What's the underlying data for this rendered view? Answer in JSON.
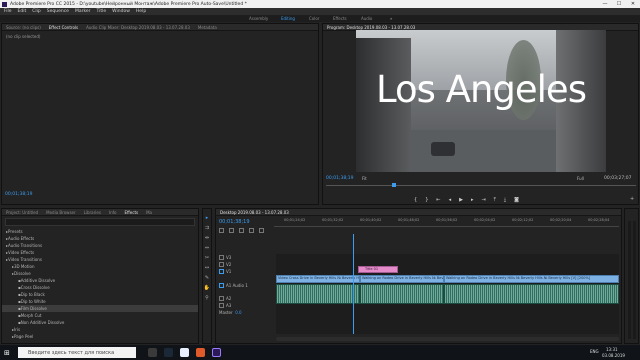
{
  "app": {
    "title": "Adobe Premiere Pro CC 2015 - D:\\youtube\\Нейронный Монтаж\\Adobe Premiere Pro Auto-Save\\Untitled *",
    "window_buttons": [
      "—",
      "☐",
      "✕"
    ]
  },
  "menu": [
    "File",
    "Edit",
    "Clip",
    "Sequence",
    "Marker",
    "Title",
    "Window",
    "Help"
  ],
  "workspaces": [
    "Assembly",
    "Editing",
    "Color",
    "Effects",
    "Audio"
  ],
  "active_workspace": "Editing",
  "source_panel": {
    "tabs": [
      "Source: (no clips)",
      "Effect Controls",
      "Audio Clip Mixer: Desktop 2019.08.03 - 13.07.28.03",
      "Metadata"
    ],
    "active_tab": "Effect Controls",
    "label": "(no clip selected)",
    "timecode": "00;01;38;19"
  },
  "program_panel": {
    "tab": "Program: Desktop 2019.08.03 - 13.07.28.03",
    "overlay_text": "Los Angeles",
    "timecode": "00;01;38;19",
    "fit": "Fit",
    "quality": "Full",
    "duration": "00;03;27;07"
  },
  "project_panel": {
    "tabs": [
      "Project: Untitled",
      "Media Browser",
      "Libraries",
      "Info",
      "Effects",
      "Ma"
    ],
    "active_tab": "Effects",
    "tree": [
      {
        "label": "Presets",
        "indent": 0
      },
      {
        "label": "Audio Effects",
        "indent": 0
      },
      {
        "label": "Audio Transitions",
        "indent": 0
      },
      {
        "label": "Video Effects",
        "indent": 0
      },
      {
        "label": "Video Transitions",
        "indent": 0
      },
      {
        "label": "3D Motion",
        "indent": 1
      },
      {
        "label": "Dissolve",
        "indent": 1
      },
      {
        "label": "Additive Dissolve",
        "indent": 2
      },
      {
        "label": "Cross Dissolve",
        "indent": 2
      },
      {
        "label": "Dip to Black",
        "indent": 2
      },
      {
        "label": "Dip to White",
        "indent": 2
      },
      {
        "label": "Film Dissolve",
        "indent": 2
      },
      {
        "label": "Morph Cut",
        "indent": 2
      },
      {
        "label": "Non Additive Dissolve",
        "indent": 2
      },
      {
        "label": "Iris",
        "indent": 1
      },
      {
        "label": "Page Peel",
        "indent": 1
      }
    ],
    "selected_item": "Film Dissolve"
  },
  "timeline": {
    "tab": "Desktop 2019.08.03 - 13.07.28.03",
    "timecode": "00;01;38;19",
    "ruler": [
      "00;01;24;02",
      "00;01;32;02",
      "00;01;40;02",
      "00;01;48;02",
      "00;01;56;02",
      "00;02;04;02",
      "00;02;12;02",
      "00;02;20;04",
      "00;02;28;04"
    ],
    "video_tracks": [
      "V3",
      "V2",
      "V1"
    ],
    "audio_tracks": [
      "A1",
      "A2",
      "A3"
    ],
    "title_clip": "Title 01",
    "video_clips": [
      "Video Cross Drive in Beverly Hills № Beverly Hills № Beverly Hills (17 [V] [235%]",
      "Walking on Rodeo Drive in Beverly Hills № Beverly Hills № [V] [235%]",
      "Walking on Rodeo Drive in Beverly Hills № Beverly Hills № Beverly Hills [V] [200%]"
    ],
    "master": "Master",
    "master_value": "0.0",
    "audio_label": "Audio 1"
  },
  "taskbar": {
    "search_placeholder": "Введите здесь текст для поиска",
    "lang": "ENG",
    "time": "13:31",
    "date": "03.08.2019"
  }
}
